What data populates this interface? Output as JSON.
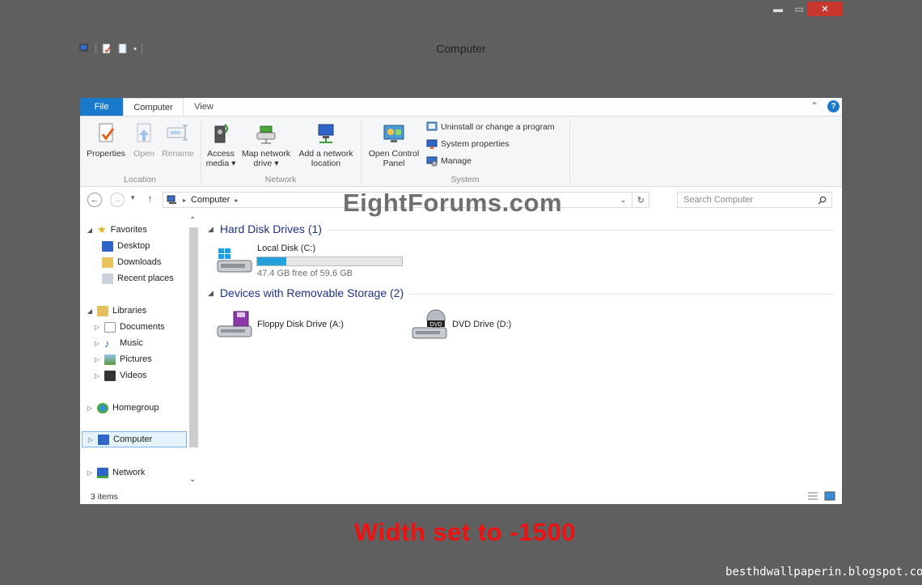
{
  "window": {
    "title": "Computer",
    "caption_buttons": {
      "minimize": "▬",
      "maximize": "▭",
      "close": "✕"
    }
  },
  "ribbon": {
    "tabs": [
      "File",
      "Computer",
      "View"
    ],
    "location": {
      "label": "Location",
      "buttons": [
        {
          "label": "Properties",
          "icon": "properties-icon",
          "enabled": true
        },
        {
          "label": "Open",
          "icon": "open-icon",
          "enabled": false
        },
        {
          "label": "Rename",
          "icon": "rename-icon",
          "enabled": false
        }
      ]
    },
    "network": {
      "label": "Network",
      "buttons": [
        {
          "line1": "Access",
          "line2": "media ▾",
          "icon": "access-media-icon"
        },
        {
          "line1": "Map network",
          "line2": "drive ▾",
          "icon": "map-network-drive-icon"
        },
        {
          "line1": "Add a network",
          "line2": "location",
          "icon": "add-network-location-icon"
        }
      ]
    },
    "system": {
      "label": "System",
      "open_control_panel": {
        "line1": "Open Control",
        "line2": "Panel"
      },
      "items": [
        "Uninstall or change a program",
        "System properties",
        "Manage"
      ]
    }
  },
  "address": {
    "path": "Computer",
    "search_placeholder": "Search Computer"
  },
  "watermark": "EightForums.com",
  "nav": {
    "favorites": "Favorites",
    "favorites_items": [
      "Desktop",
      "Downloads",
      "Recent places"
    ],
    "libraries": "Libraries",
    "libraries_items": [
      "Documents",
      "Music",
      "Pictures",
      "Videos"
    ],
    "homegroup": "Homegroup",
    "computer": "Computer",
    "network": "Network"
  },
  "content": {
    "hard_disk_section": "Hard Disk Drives (1)",
    "local_disk": {
      "name": "Local Disk (C:)",
      "free": "47.4 GB free of 59.6 GB",
      "used_fraction": 0.2
    },
    "removable_section": "Devices with Removable Storage (2)",
    "floppy": "Floppy Disk Drive (A:)",
    "dvd": "DVD Drive (D:)",
    "dvd_badge": "DVD"
  },
  "status": {
    "items": "3 items"
  },
  "caption": "Width set to -1500",
  "credit": "besthdwallpaperin.blogspot.com",
  "colors": {
    "accent": "#1979ca",
    "caption_red": "#ee1111",
    "progress": "#26a0da",
    "background": "#5f5f5f"
  }
}
